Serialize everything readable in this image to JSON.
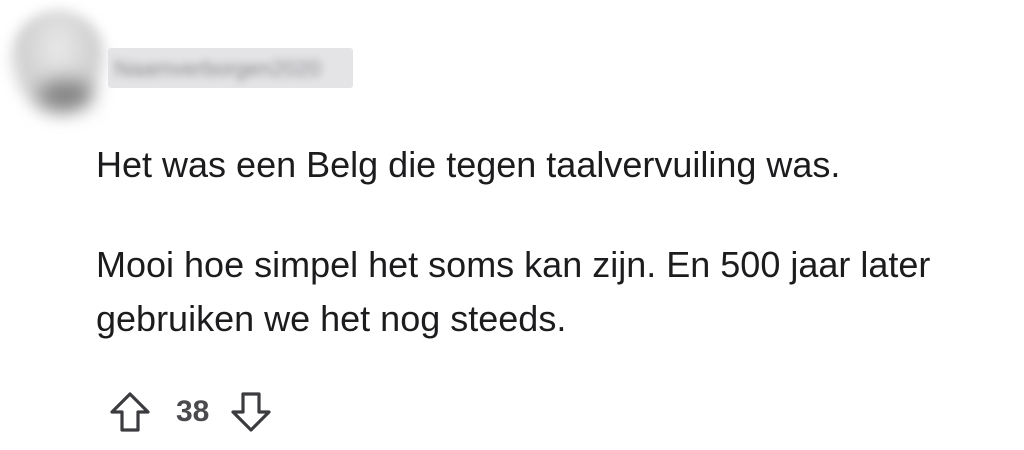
{
  "comment": {
    "author": "Naamverborgen2020",
    "paragraphs": [
      "Het was een Belg die tegen taalvervuiling was.",
      "Mooi hoe simpel het soms kan zijn. En 500 jaar later gebruiken we het nog steeds."
    ],
    "votes": {
      "count": "38",
      "upvote_icon": "arrow-up-outline-icon",
      "downvote_icon": "arrow-down-outline-icon"
    }
  },
  "colors": {
    "text": "#1c1c1e",
    "vote_count": "#4a4a4f",
    "icon": "#3c3c40"
  }
}
